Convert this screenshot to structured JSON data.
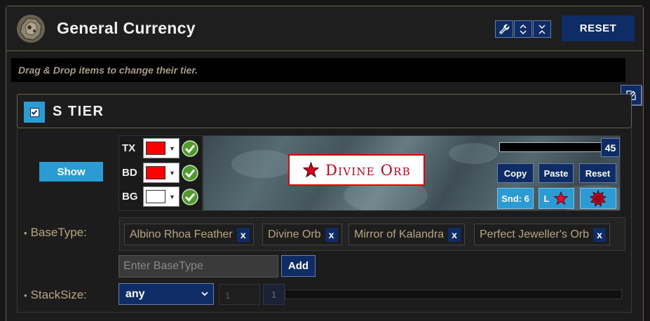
{
  "header": {
    "title": "General Currency",
    "reset_label": "RESET",
    "tool_icons": [
      "wrench-icon",
      "expand-icon",
      "collapse-icon"
    ]
  },
  "hint": "Drag & Drop items to change their tier.",
  "tier": {
    "title": "S TIER",
    "checked": true
  },
  "show_label": "Show",
  "colors": [
    {
      "label": "TX",
      "color": "#ff0000"
    },
    {
      "label": "BD",
      "color": "#ff0000"
    },
    {
      "label": "BG",
      "color": "#ffffff"
    }
  ],
  "preview": {
    "item_name": "Divine Orb",
    "font_size": "45"
  },
  "buttons": {
    "copy": "Copy",
    "paste": "Paste",
    "reset": "Reset",
    "sound": "Snd: 6",
    "minimap": "L"
  },
  "basetype": {
    "label": "BaseType:",
    "items": [
      "Albino Rhoa Feather",
      "Divine Orb",
      "Mirror of Kalandra",
      "Perfect Jeweller's Orb"
    ],
    "remove_label": "x",
    "placeholder": "Enter BaseType",
    "add_label": "Add"
  },
  "stacksize": {
    "label": "StackSize:",
    "operator": "any",
    "value": "1",
    "badge": "1"
  },
  "accent": {
    "blue": "#0e2d66",
    "cyan": "#2a9bd3",
    "tan": "#b8a583",
    "red": "#e00000"
  }
}
